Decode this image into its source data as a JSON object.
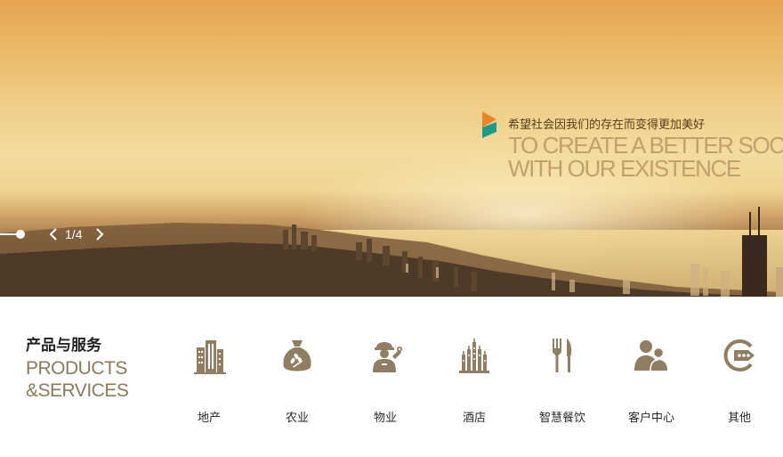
{
  "hero": {
    "slogan_cn": "希望社会因我们的存在而变得更加美好",
    "slogan_en_line1": "TO CREATE A BETTER SOCIETY",
    "slogan_en_line2": "WITH OUR EXISTENCE",
    "pager": {
      "current": "1",
      "total": "4",
      "separator": "/"
    },
    "logo_colors": [
      "#e8862a",
      "#1e9a8a"
    ]
  },
  "services": {
    "title_cn": "产品与服务",
    "title_en_line1": "PRODUCTS",
    "title_en_line2": "&SERVICES",
    "icon_color": "#8f7e62",
    "items": [
      {
        "label": "地产",
        "icon": "buildings-icon"
      },
      {
        "label": "农业",
        "icon": "grain-sack-icon"
      },
      {
        "label": "物业",
        "icon": "worker-wrench-icon"
      },
      {
        "label": "酒店",
        "icon": "hotel-icon"
      },
      {
        "label": "智慧餐饮",
        "icon": "fork-knife-icon"
      },
      {
        "label": "客户中心",
        "icon": "users-icon"
      },
      {
        "label": "其他",
        "icon": "more-arrow-icon"
      }
    ]
  }
}
